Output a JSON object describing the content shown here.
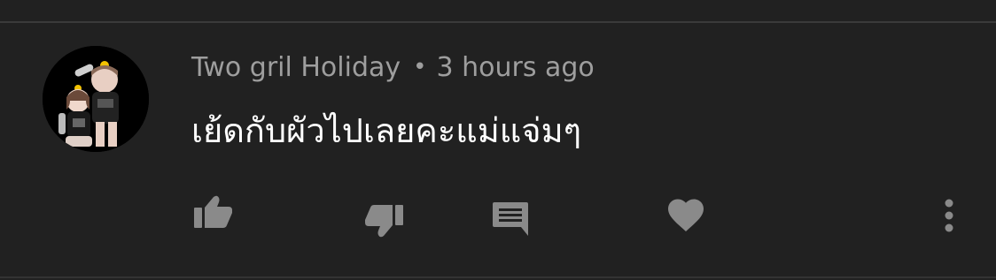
{
  "comment": {
    "author": "Two gril Holiday",
    "separator": "•",
    "timestamp": "3 hours ago",
    "text": "เย้ดกับผัวไปเลยคะแม่แจ่มๆ"
  },
  "actions": {
    "like_icon": "thumbs-up-icon",
    "dislike_icon": "thumbs-down-icon",
    "reply_icon": "comment-icon",
    "heart_icon": "heart-icon",
    "more_icon": "more-vertical-icon"
  },
  "colors": {
    "background": "#212121",
    "meta_text": "#9e9e9e",
    "comment_text": "#ffffff",
    "icon": "#8a8a8a"
  }
}
